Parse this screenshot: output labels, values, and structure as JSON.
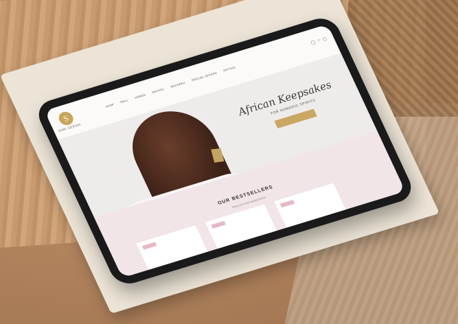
{
  "site": {
    "brand_initial": "S",
    "brand_name": "SIMI SERAH",
    "menu": [
      "SHOP",
      "WALL",
      "HOMEN",
      "WATHOL",
      "BEESWAX",
      "SPECIAL OFFERS",
      "GIFTING"
    ],
    "icons": [
      "user-icon",
      "search-icon",
      "cart-icon"
    ],
    "hero_script": "African Keepsakes",
    "hero_sub": "FOR NOMADIC SPIRITS",
    "section_title": "OUR BESTSELLERS",
    "section_sub": "Shop our most wanted items"
  },
  "colors": {
    "gold": "#cba764",
    "pink": "#f1e5e8",
    "tag": "#e7b9c4"
  }
}
